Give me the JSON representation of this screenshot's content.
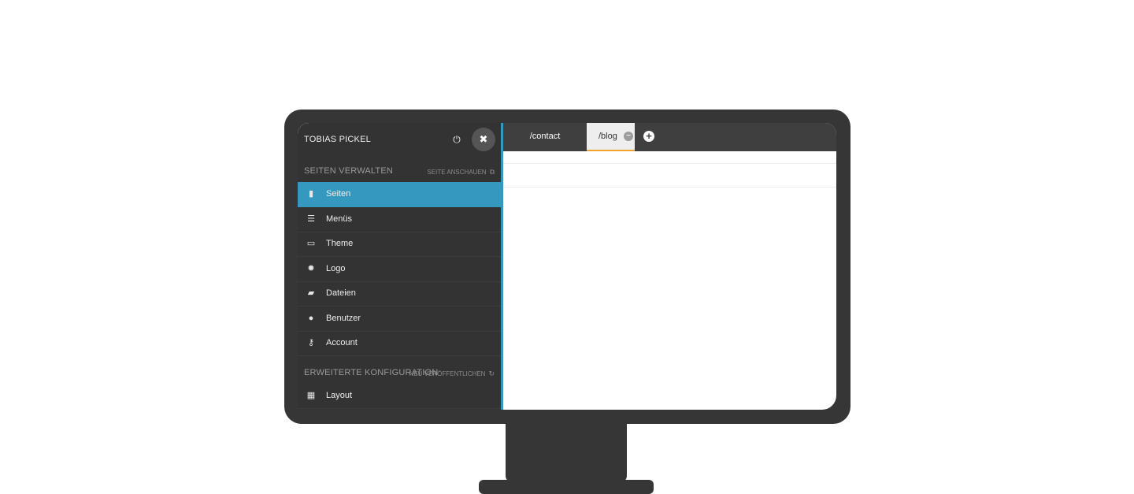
{
  "user": {
    "name": "TOBIAS PICKEL"
  },
  "icons": {
    "power": "power-icon",
    "close": "close-icon",
    "external": "external-link-icon",
    "refresh": "refresh-icon"
  },
  "sections": [
    {
      "title": "SEITEN VERWALTEN",
      "link": "SEITE ANSCHAUEN"
    },
    {
      "title": "ERWEITERTE KONFIGURATION",
      "link": "NEU VERÖFFENTLICHEN"
    }
  ],
  "menu": [
    {
      "label": "Seiten",
      "icon": "file-icon",
      "active": true
    },
    {
      "label": "Menüs",
      "icon": "list-icon",
      "active": false
    },
    {
      "label": "Theme",
      "icon": "monitor-icon",
      "active": false
    },
    {
      "label": "Logo",
      "icon": "badge-icon",
      "active": false
    },
    {
      "label": "Dateien",
      "icon": "folder-open-icon",
      "active": false
    },
    {
      "label": "Benutzer",
      "icon": "user-icon",
      "active": false
    },
    {
      "label": "Account",
      "icon": "key-icon",
      "active": false
    }
  ],
  "menu2": [
    {
      "label": "Layout",
      "icon": "grid-icon",
      "active": false
    }
  ],
  "tabs": [
    {
      "label": "/contact",
      "active": false
    },
    {
      "label": "/blog",
      "active": true
    }
  ],
  "colors": {
    "accent": "#3598be",
    "tab_underline": "#f0a22a",
    "monitor": "#363636"
  }
}
